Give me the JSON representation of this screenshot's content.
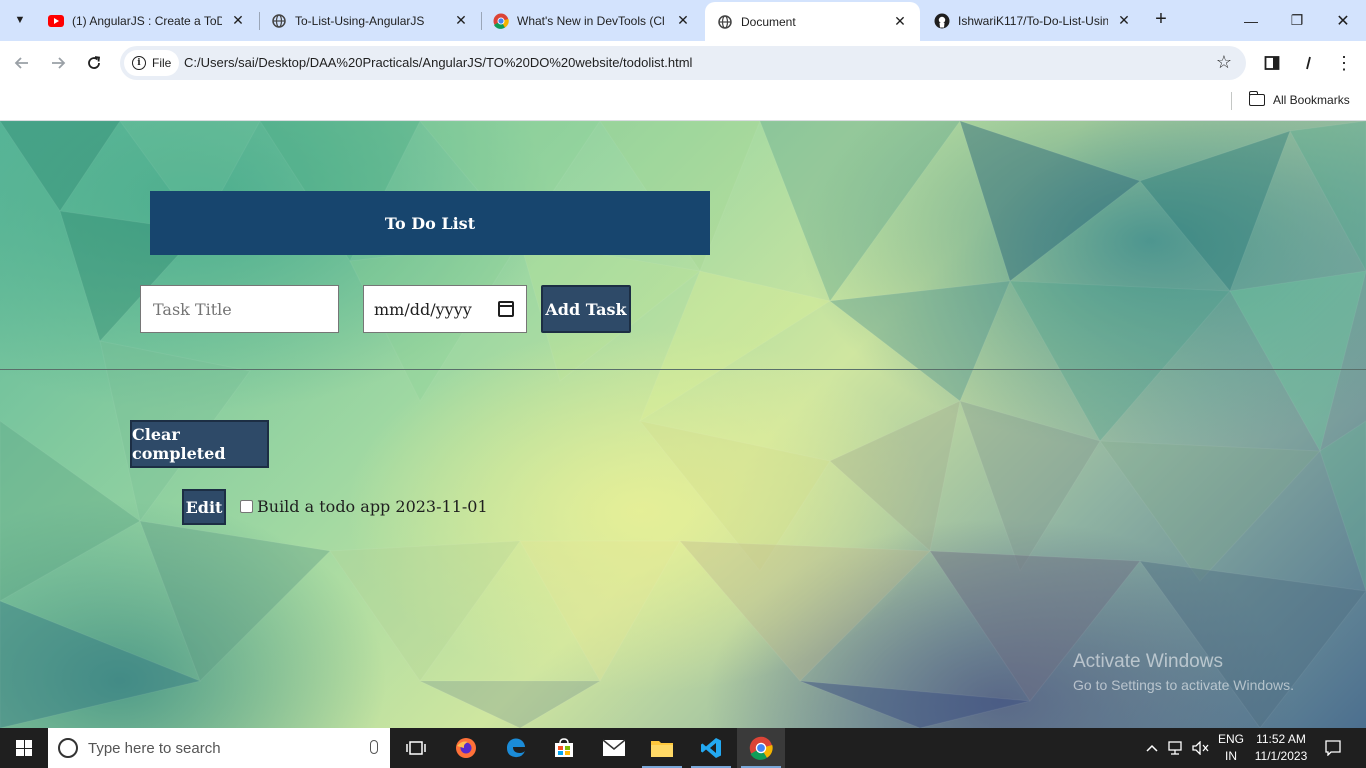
{
  "browser": {
    "tabs": [
      {
        "title": "(1) AngularJS : Create a ToD",
        "favicon": "youtube-icon",
        "active": false
      },
      {
        "title": "To-List-Using-AngularJS",
        "favicon": "globe-icon",
        "active": false
      },
      {
        "title": "What's New in DevTools (Cl",
        "favicon": "chrome-icon",
        "active": false
      },
      {
        "title": "Document",
        "favicon": "globe-icon",
        "active": true
      },
      {
        "title": "IshwariK117/To-Do-List-Usin",
        "favicon": "github-icon",
        "active": false
      }
    ],
    "address": {
      "chip_label": "File",
      "url": "C:/Users/sai/Desktop/DAA%20Practicals/AngularJS/TO%20DO%20website/todolist.html"
    },
    "bookmarks": {
      "all_label": "All Bookmarks"
    }
  },
  "page": {
    "title": "To Do List",
    "task_placeholder": "Task Title",
    "date_placeholder": "mm/dd/yyyy",
    "add_label": "Add Task",
    "clear_label": "Clear completed",
    "todos": [
      {
        "edit_label": "Edit",
        "text": "Build a todo app 2023-11-01",
        "done": false
      }
    ]
  },
  "watermark": {
    "line1": "Activate Windows",
    "line2": "Go to Settings to activate Windows."
  },
  "taskbar": {
    "search_placeholder": "Type here to search",
    "lang_line1": "ENG",
    "lang_line2": "IN",
    "time": "11:52 AM",
    "date": "11/1/2023"
  },
  "colors": {
    "title_bar": "#17456e",
    "button": "#2e4a68",
    "tabstrip": "#d3e3fd"
  }
}
